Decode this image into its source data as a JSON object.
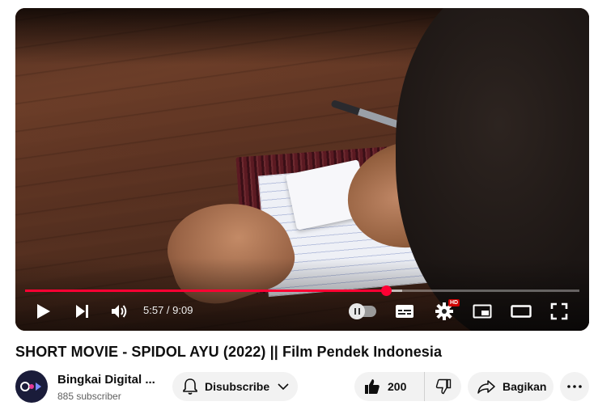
{
  "player": {
    "time_display": "5:57 / 9:09",
    "progress_fraction": 0.6507,
    "buffer_fraction": 0.68,
    "quality_badge": "HD",
    "accent_color": "#ff0033"
  },
  "video": {
    "title": "SHORT MOVIE - SPIDOL AYU (2022) || Film Pendek Indonesia"
  },
  "channel": {
    "name": "Bingkai Digital ...",
    "subscribers": "885 subscriber"
  },
  "actions": {
    "subscribe_label": "Disubscribe",
    "like_count": "200",
    "share_label": "Bagikan"
  },
  "icons": {
    "play": "play-icon",
    "next": "skip-next-icon",
    "volume": "volume-icon",
    "autoplay": "autoplay-toggle",
    "subtitles": "subtitles-icon",
    "settings": "gear-icon",
    "miniplayer": "miniplayer-icon",
    "theater": "theater-mode-icon",
    "fullscreen": "fullscreen-icon",
    "bell": "bell-icon",
    "like": "thumbs-up-icon",
    "dislike": "thumbs-down-icon",
    "share": "share-icon",
    "more": "more-horizontal-icon"
  }
}
